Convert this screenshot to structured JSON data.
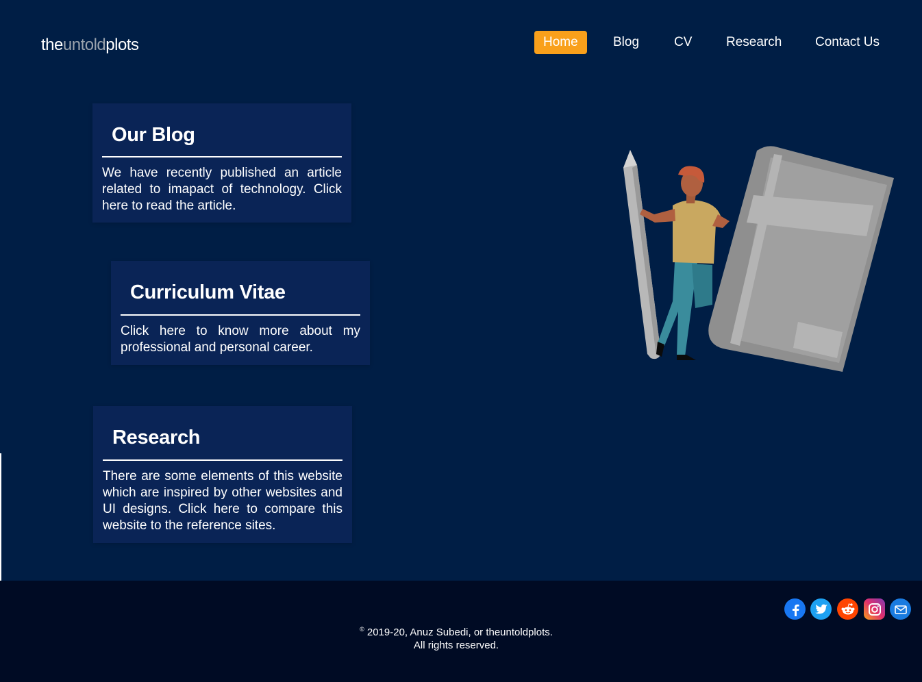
{
  "logo": {
    "part1": "the",
    "part2": "untold",
    "part3": "plots"
  },
  "nav": {
    "items": [
      {
        "label": "Home",
        "active": true
      },
      {
        "label": "Blog",
        "active": false
      },
      {
        "label": "CV",
        "active": false
      },
      {
        "label": "Research",
        "active": false
      },
      {
        "label": "Contact Us",
        "active": false
      }
    ]
  },
  "cards": [
    {
      "title": "Our Blog",
      "body": "We have recently published an article related to imapact of technology. Click here to read the article."
    },
    {
      "title": "Curriculum Vitae",
      "body": "Click here to know more about my professional and personal career."
    },
    {
      "title": "Research",
      "body": "There are some elements of this website which are inspired by other websites and UI designs. Click here to compare this website to the reference sites."
    }
  ],
  "footer": {
    "copyright_symbol": "©",
    "copyright_line1": "2019-20, Anuz Subedi, or theuntoldplots.",
    "copyright_line2": "All rights reserved.",
    "socials": [
      {
        "icon": "facebook-icon",
        "color": "#1877f2"
      },
      {
        "icon": "twitter-icon",
        "color": "#1da1f2"
      },
      {
        "icon": "reddit-icon",
        "color": "#ff4500"
      },
      {
        "icon": "instagram-icon",
        "color": "#c13584"
      },
      {
        "icon": "email-icon",
        "color": "#1a7be0"
      }
    ]
  },
  "colors": {
    "background": "#001e45",
    "card": "#0a2456",
    "accent": "#f9a01b",
    "footer": "#000b24"
  }
}
